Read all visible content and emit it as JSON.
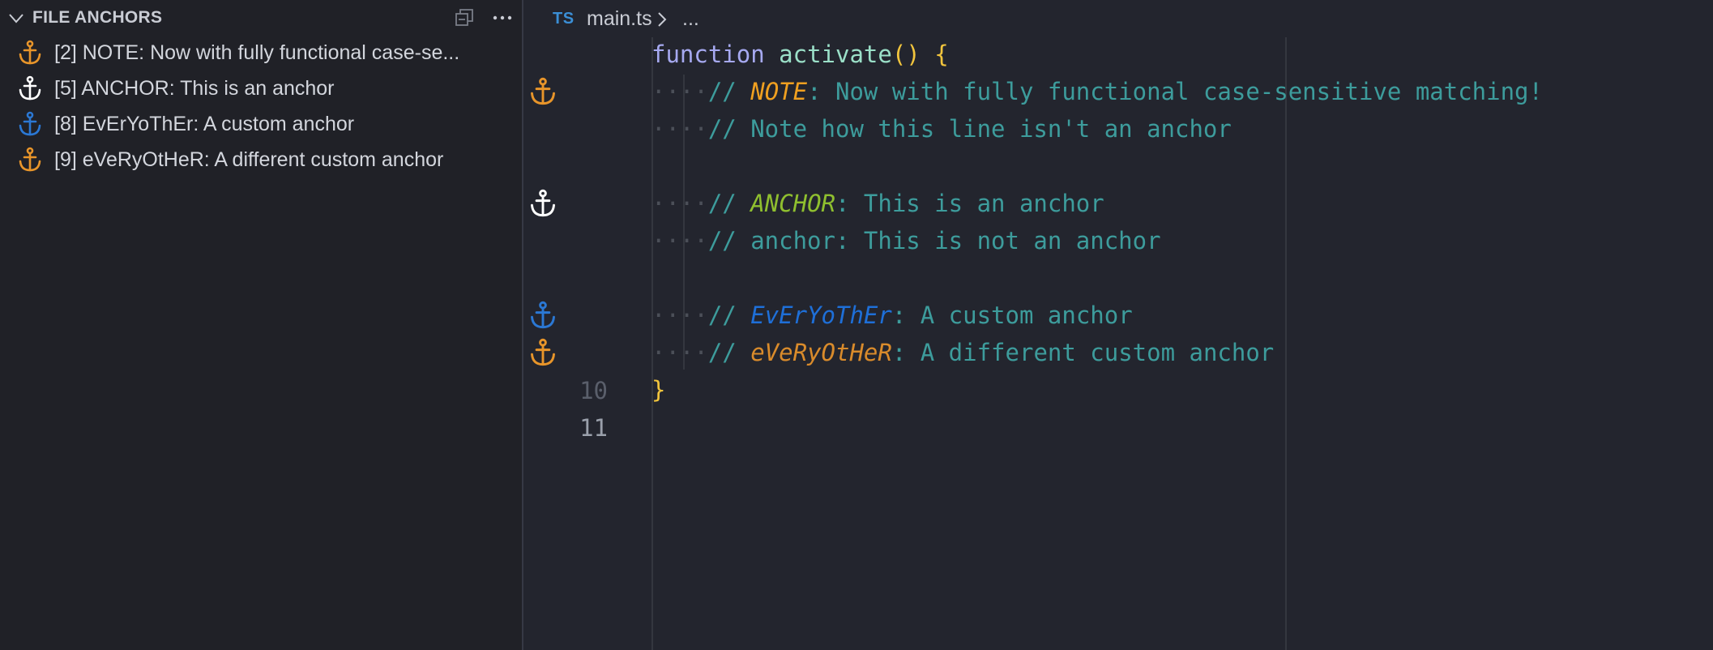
{
  "colors": {
    "anchor_orange": "#e8952a",
    "anchor_white": "#ffffff",
    "anchor_blue": "#2b78d4"
  },
  "sidebar": {
    "title": "FILE ANCHORS",
    "icons": [
      "chevron-down-icon",
      "collapse-all-icon",
      "more-actions-icon"
    ],
    "items": [
      {
        "label": "[2] NOTE: Now with fully functional case-se...",
        "icon": "anchor-icon",
        "color": "#e8952a"
      },
      {
        "label": "[5] ANCHOR: This is an anchor",
        "icon": "anchor-icon",
        "color": "#ffffff"
      },
      {
        "label": "[8] EvErYoThEr: A custom anchor",
        "icon": "anchor-icon",
        "color": "#2b78d4"
      },
      {
        "label": "[9] eVeRyOtHeR: A different custom anchor",
        "icon": "anchor-icon",
        "color": "#e8952a"
      }
    ]
  },
  "breadcrumb": {
    "lang_badge": "TS",
    "file": "main.ts",
    "ellipsis": "..."
  },
  "editor": {
    "line1": {
      "keyword": "function",
      "name": "activate",
      "parens": "()",
      "brace": "{"
    },
    "line2": {
      "slashes": "//",
      "tag": "NOTE",
      "rest": ": Now with fully functional case-sensitive matching!"
    },
    "line3": {
      "text": "// Note how this line isn't an anchor"
    },
    "line5": {
      "slashes": "//",
      "tag": "ANCHOR",
      "rest": ": This is an anchor"
    },
    "line6": {
      "text": "// anchor: This is not an anchor"
    },
    "line8": {
      "slashes": "//",
      "tag": "EvErYoThEr",
      "rest": ": A custom anchor"
    },
    "line9": {
      "slashes": "//",
      "tag": "eVeRyOtHeR",
      "rest": ": A different custom anchor"
    },
    "line10": {
      "number": "10",
      "brace": "}"
    },
    "line11": {
      "number": "11"
    },
    "indent_dots": "····"
  }
}
